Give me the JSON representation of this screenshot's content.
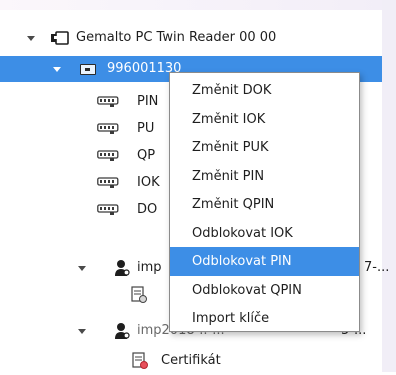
{
  "tree": {
    "reader_label": "Gemalto PC Twin Reader 00 00",
    "card_label": "996001130",
    "items": [
      {
        "label": "PIN"
      },
      {
        "label": "PU"
      },
      {
        "label": "QP"
      },
      {
        "label": "IOK"
      },
      {
        "label": "DO"
      }
    ],
    "import1_label": "imp",
    "import1_suffix": "7-...",
    "import2_label": "imp2018-..-...",
    "import2_suffix": "5-...",
    "cert_label": "Certifikát"
  },
  "context_menu": {
    "items": [
      "Změnit DOK",
      "Změnit IOK",
      "Změnit PUK",
      "Změnit PIN",
      "Změnit QPIN",
      "Odblokovat IOK",
      "Odblokovat PIN",
      "Odblokovat QPIN",
      "Import klíče"
    ],
    "highlighted_index": 6
  },
  "colors": {
    "selection": "#3d8ee6",
    "background": "#ffffff"
  }
}
